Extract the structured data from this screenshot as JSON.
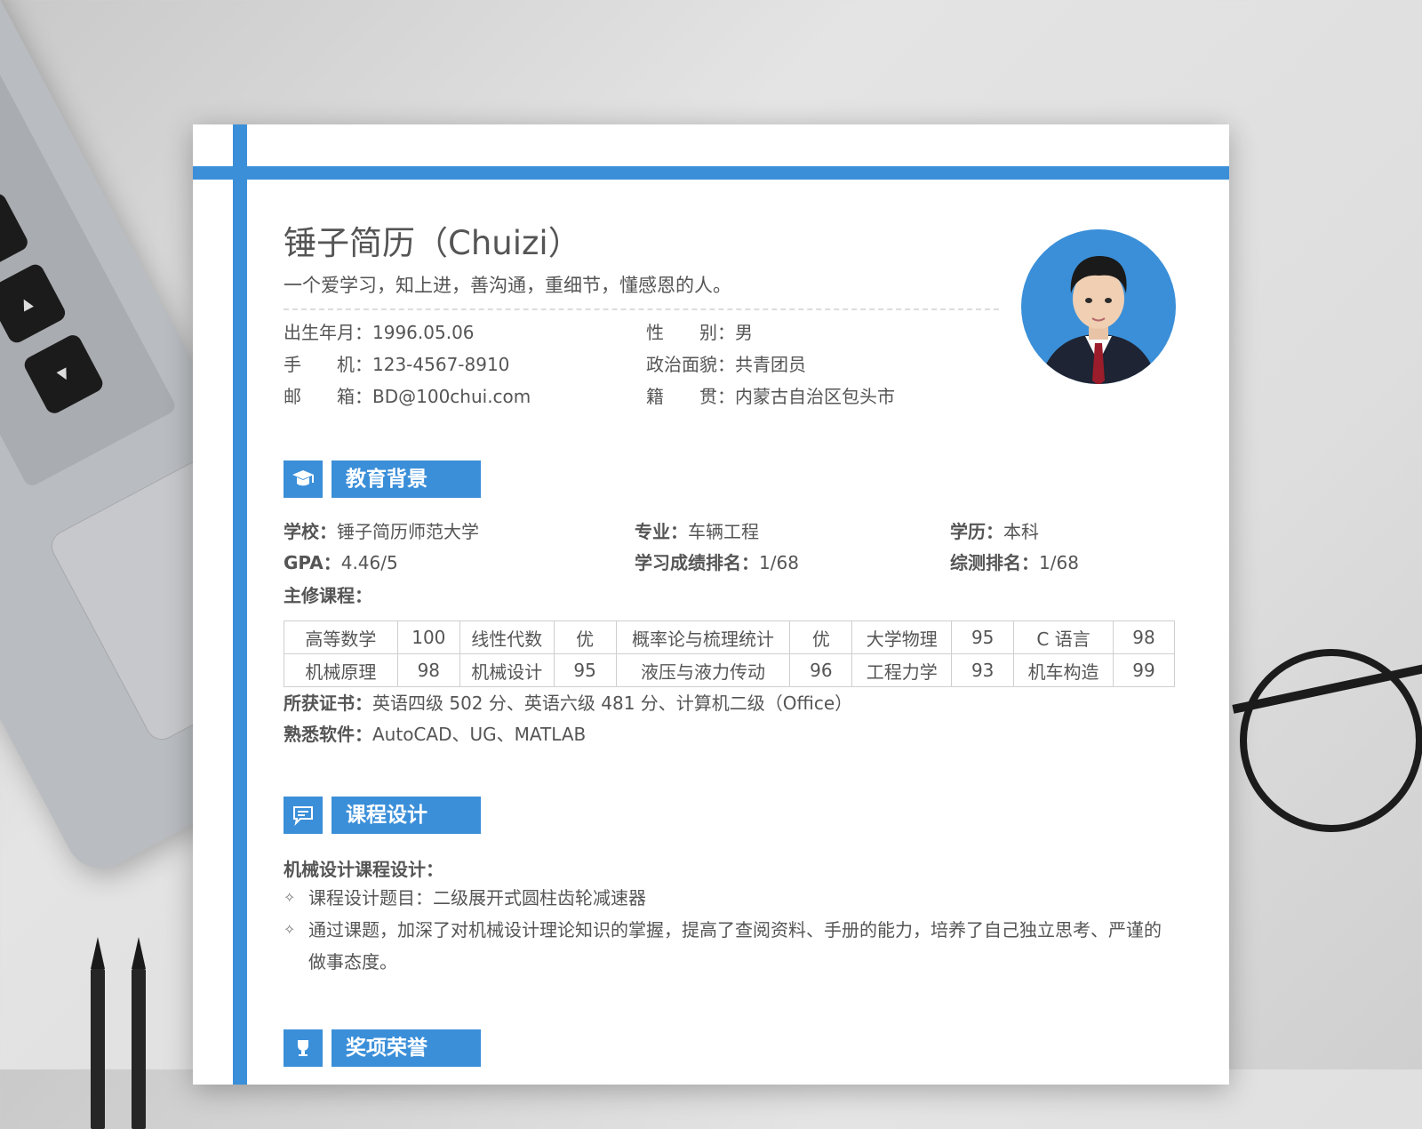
{
  "resume": {
    "name": "锤子简历（Chuizi）",
    "tagline": "一个爱学习，知上进，善沟通，重细节，懂感恩的人。",
    "info": [
      {
        "label": "出生年月",
        "value": "1996.05.06"
      },
      {
        "label": "性　　别",
        "value": "男"
      },
      {
        "label": "手　　机",
        "value": "123-4567-8910"
      },
      {
        "label": "政治面貌",
        "value": "共青团员"
      },
      {
        "label": "邮　　箱",
        "value": "BD@100chui.com"
      },
      {
        "label": "籍　　贯",
        "value": "内蒙古自治区包头市"
      }
    ]
  },
  "education": {
    "title": "教育背景",
    "icon": "graduation-cap-icon",
    "fields": [
      {
        "label": "学校：",
        "value": "锤子简历师范大学"
      },
      {
        "label": "专业：",
        "value": "车辆工程"
      },
      {
        "label": "学历：",
        "value": "本科"
      },
      {
        "label": "GPA：",
        "value": "4.46/5"
      },
      {
        "label": "学习成绩排名：",
        "value": "1/68"
      },
      {
        "label": "综测排名：",
        "value": "1/68"
      }
    ],
    "courses_label": "主修课程：",
    "courses": [
      [
        "高等数学",
        "100",
        "线性代数",
        "优",
        "概率论与梳理统计",
        "优",
        "大学物理",
        "95",
        "C 语言",
        "98"
      ],
      [
        "机械原理",
        "98",
        "机械设计",
        "95",
        "液压与液力传动",
        "96",
        "工程力学",
        "93",
        "机车构造",
        "99"
      ]
    ],
    "cert_label": "所获证书：",
    "cert_value": "英语四级 502 分、英语六级 481 分、计算机二级（Office）",
    "software_label": "熟悉软件：",
    "software_value": "AutoCAD、UG、MATLAB"
  },
  "course_design": {
    "title": "课程设计",
    "icon": "chat-bubble-icon",
    "subtitle": "机械设计课程设计：",
    "bullet_mark": "✧",
    "bullets": [
      "课程设计题目：二级展开式圆柱齿轮减速器",
      "通过课题，加深了对机械设计理论知识的掌握，提高了查阅资料、手册的能力，培养了自己独立思考、严谨的做事态度。"
    ]
  },
  "awards": {
    "title": "奖项荣誉",
    "icon": "trophy-icon"
  },
  "colors": {
    "accent": "#3b8fd9",
    "text": "#555555"
  }
}
